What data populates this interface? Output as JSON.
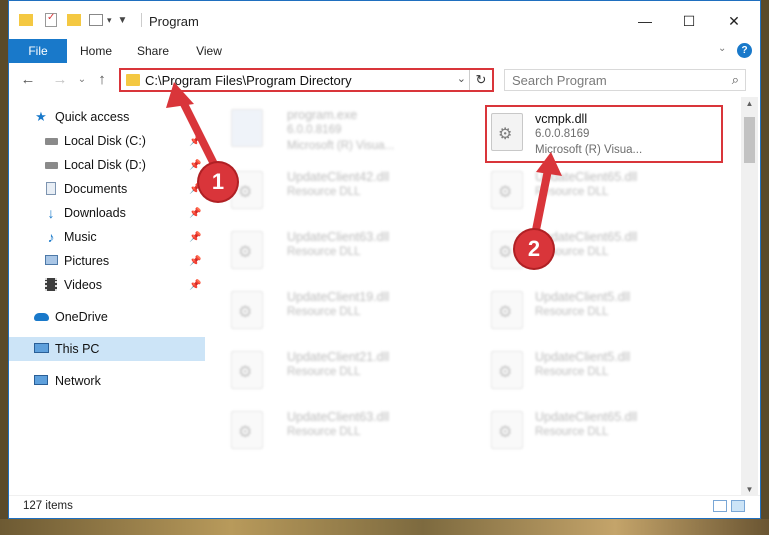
{
  "window": {
    "title": "Program",
    "controls": {
      "minimize": "—",
      "maximize": "☐",
      "close": "✕"
    }
  },
  "ribbon": {
    "tabs": [
      {
        "label": "File"
      },
      {
        "label": "Home"
      },
      {
        "label": "Share"
      },
      {
        "label": "View"
      }
    ]
  },
  "nav": {
    "back": "←",
    "forward": "→",
    "recent": "⌄",
    "up": "↑",
    "address": "C:\\Program Files\\Program Directory",
    "search_placeholder": "Search Program"
  },
  "sidebar": {
    "items": [
      {
        "label": "Quick access",
        "icon": "star-icon"
      },
      {
        "label": "Local Disk (C:)",
        "icon": "disk-icon"
      },
      {
        "label": "Local Disk (D:)",
        "icon": "disk-icon"
      },
      {
        "label": "Documents",
        "icon": "document-icon"
      },
      {
        "label": "Downloads",
        "icon": "download-icon"
      },
      {
        "label": "Music",
        "icon": "music-icon"
      },
      {
        "label": "Pictures",
        "icon": "picture-icon"
      },
      {
        "label": "Videos",
        "icon": "video-icon"
      },
      {
        "label": "OneDrive",
        "icon": "cloud-icon"
      },
      {
        "label": "This PC",
        "icon": "computer-icon",
        "selected": true
      },
      {
        "label": "Network",
        "icon": "network-icon"
      }
    ]
  },
  "files": {
    "highlighted": {
      "name": "vcmpk.dll",
      "version": "6.0.0.8169",
      "description": "Microsoft (R) Visua..."
    },
    "items": [
      {
        "name": "program.exe",
        "sub": "6.0.0.8169",
        "sub2": "Microsoft (R) Visua..."
      },
      {
        "name": "UpdateClient42.dll",
        "sub": "Resource DLL"
      },
      {
        "name": "UpdateClient65.dll",
        "sub": "Resource DLL"
      },
      {
        "name": "UpdateClient63.dll",
        "sub": "Resource DLL"
      },
      {
        "name": "UpdateClient65.dll",
        "sub": "Resource DLL"
      },
      {
        "name": "UpdateClient19.dll",
        "sub": "Resource DLL"
      },
      {
        "name": "UpdateClient5.dll",
        "sub": "Resource DLL"
      },
      {
        "name": "UpdateClient21.dll",
        "sub": "Resource DLL"
      },
      {
        "name": "UpdateClient5.dll",
        "sub": "Resource DLL"
      },
      {
        "name": "UpdateClient63.dll",
        "sub": "Resource DLL"
      },
      {
        "name": "UpdateClient65.dll",
        "sub": "Resource DLL"
      }
    ]
  },
  "status": {
    "item_count": "127 items"
  },
  "annotations": {
    "step1": "1",
    "step2": "2",
    "color": "#d9353a"
  }
}
